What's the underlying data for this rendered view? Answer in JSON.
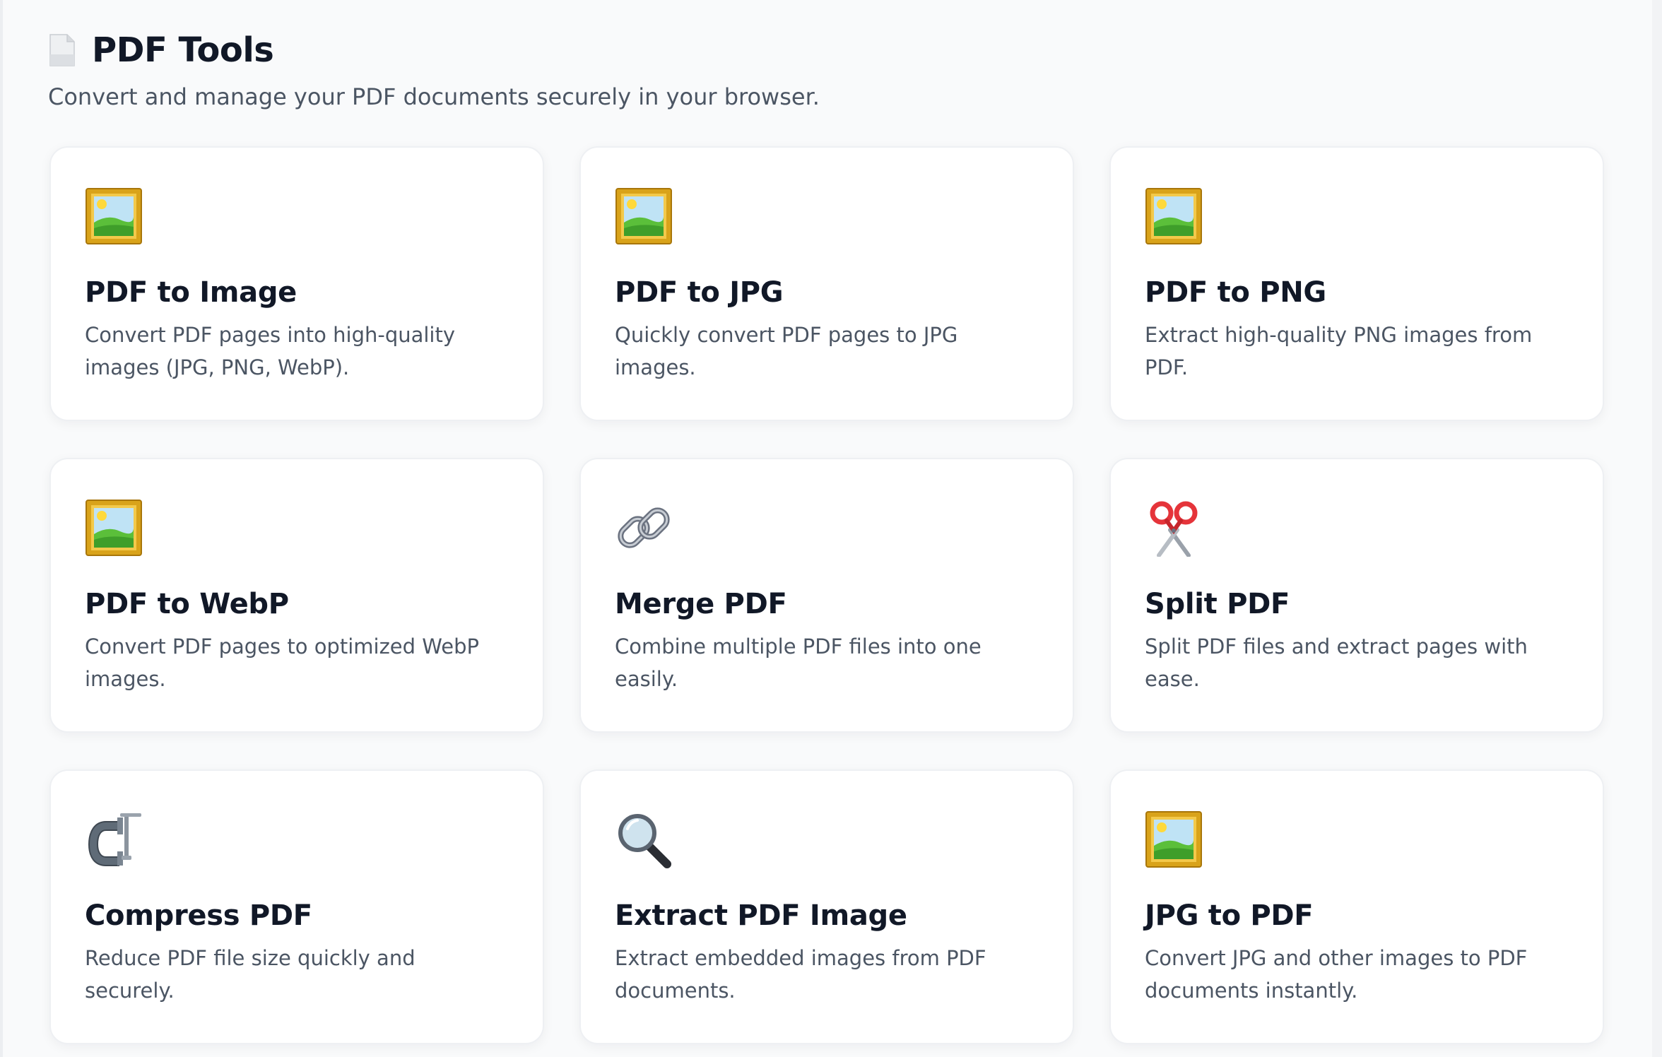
{
  "header": {
    "icon": "document-icon",
    "title": "PDF Tools",
    "subtitle": "Convert and manage your PDF documents securely in your browser."
  },
  "tools": [
    {
      "icon": "framed-picture-icon",
      "title": "PDF to Image",
      "description": "Convert PDF pages into high-quality images (JPG, PNG, WebP)."
    },
    {
      "icon": "framed-picture-icon",
      "title": "PDF to JPG",
      "description": "Quickly convert PDF pages to JPG images."
    },
    {
      "icon": "framed-picture-icon",
      "title": "PDF to PNG",
      "description": "Extract high-quality PNG images from PDF."
    },
    {
      "icon": "framed-picture-icon",
      "title": "PDF to WebP",
      "description": "Convert PDF pages to optimized WebP images."
    },
    {
      "icon": "link-icon",
      "title": "Merge PDF",
      "description": "Combine multiple PDF files into one easily."
    },
    {
      "icon": "scissors-icon",
      "title": "Split PDF",
      "description": "Split PDF files and extract pages with ease."
    },
    {
      "icon": "clamp-icon",
      "title": "Compress PDF",
      "description": "Reduce PDF file size quickly and securely."
    },
    {
      "icon": "magnifying-glass-icon",
      "title": "Extract PDF Image",
      "description": "Extract embedded images from PDF documents."
    },
    {
      "icon": "framed-picture-icon",
      "title": "JPG to PDF",
      "description": "Convert JPG and other images to PDF documents instantly."
    }
  ]
}
